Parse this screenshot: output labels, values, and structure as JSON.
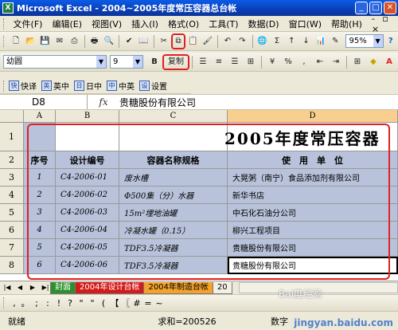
{
  "window": {
    "title": "Microsoft Excel - 2004~2005年度常压容器总台帐",
    "app_icon": "excel-icon"
  },
  "menu": {
    "items": [
      "文件(F)",
      "编辑(E)",
      "视图(V)",
      "插入(I)",
      "格式(O)",
      "工具(T)",
      "数据(D)",
      "窗口(W)",
      "帮助(H)"
    ],
    "help_placeholder": "键入需要帮助的问题"
  },
  "toolbar2": {
    "font_name": "幼圆",
    "font_size": "9",
    "bold_label": "B",
    "copy_label": "复制",
    "zoom": "95%"
  },
  "ime_bar": {
    "items": [
      {
        "icon": "快",
        "label": "快译"
      },
      {
        "icon": "英",
        "label": "英中"
      },
      {
        "icon": "日",
        "label": "日中"
      },
      {
        "icon": "中",
        "label": "中英"
      },
      {
        "icon": "设",
        "label": "设置"
      }
    ]
  },
  "formula_bar": {
    "cell_ref": "D8",
    "fx": "fx",
    "value": "贵糖股份有限公司"
  },
  "columns": [
    "A",
    "B",
    "C",
    "D"
  ],
  "sheet": {
    "title": "2005年度常压容器",
    "headers": [
      "序号",
      "设计编号",
      "容器名称规格",
      "使　用　单　位"
    ],
    "rows": [
      {
        "n": "1",
        "code": "C4-2006-01",
        "name": "废水槽",
        "unit": "大晃粥（南宁）食品添加剂有限公司"
      },
      {
        "n": "2",
        "code": "C4-2006-02",
        "name": "Φ500集（分）水器",
        "unit": "新华书店"
      },
      {
        "n": "3",
        "code": "C4-2006-03",
        "name": "15m²埋地油罐",
        "unit": "中石化石油分公司"
      },
      {
        "n": "4",
        "code": "C4-2006-04",
        "name": "冷凝水罐（0.15）",
        "unit": "柳兴工程项目"
      },
      {
        "n": "5",
        "code": "C4-2006-05",
        "name": "TDF3.5冷凝器",
        "unit": "贵糖股份有限公司"
      },
      {
        "n": "6",
        "code": "C4-2006-06",
        "name": "TDF3.5冷凝器",
        "unit": "贵糖股份有限公司"
      }
    ],
    "row_numbers": [
      "1",
      "2",
      "3",
      "4",
      "5",
      "6",
      "7",
      "8"
    ]
  },
  "tabs": [
    {
      "label": "封面",
      "style": "green"
    },
    {
      "label": "2004年设计台帐",
      "style": "red"
    },
    {
      "label": "2004年制造台帐",
      "style": "orange"
    },
    {
      "label": "20",
      "style": "plain"
    }
  ],
  "draw_symbols": [
    ",",
    "。",
    ";",
    ":",
    "!",
    "?",
    "\"",
    "\"",
    "(",
    "【",
    "〖",
    "#",
    "=",
    "~"
  ],
  "status": {
    "ready": "就绪",
    "sum": "求和=200526",
    "num": "数字"
  },
  "watermarks": {
    "baidu": "Bai度经验",
    "site": "jingyan.baidu.com"
  }
}
